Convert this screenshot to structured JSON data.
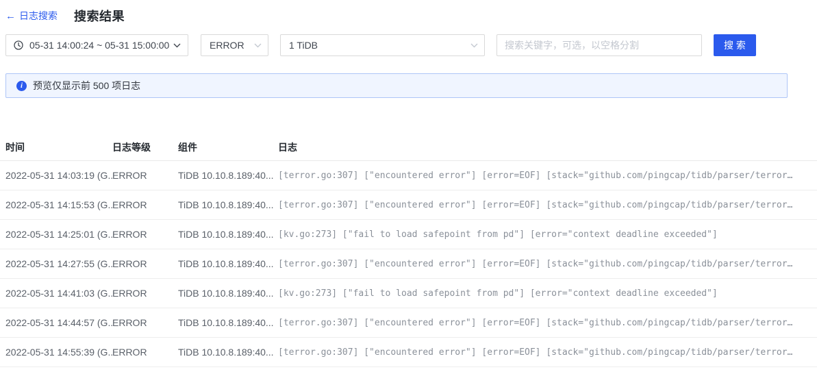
{
  "header": {
    "back_arrow": "←",
    "back_label": "日志搜索",
    "title": "搜索结果"
  },
  "filters": {
    "time_range": "05-31 14:00:24 ~ 05-31 15:00:00",
    "level_selected": "ERROR",
    "components_selected": "1 TiDB",
    "keyword_placeholder": "搜索关键字，可选，以空格分割",
    "search_label": "搜 索"
  },
  "alert": {
    "text": "预览仅显示前 500 项日志"
  },
  "table": {
    "columns": [
      "时间",
      "日志等级",
      "组件",
      "日志"
    ],
    "rows": [
      {
        "time": "2022-05-31 14:03:19 (G...",
        "level": "ERROR",
        "component": "TiDB 10.10.8.189:40...",
        "log": "[terror.go:307] [\"encountered error\"] [error=EOF] [stack=\"github.com/pingcap/tidb/parser/terror…"
      },
      {
        "time": "2022-05-31 14:15:53 (G...",
        "level": "ERROR",
        "component": "TiDB 10.10.8.189:40...",
        "log": "[terror.go:307] [\"encountered error\"] [error=EOF] [stack=\"github.com/pingcap/tidb/parser/terror…"
      },
      {
        "time": "2022-05-31 14:25:01 (G...",
        "level": "ERROR",
        "component": "TiDB 10.10.8.189:40...",
        "log": "[kv.go:273] [\"fail to load safepoint from pd\"] [error=\"context deadline exceeded\"]"
      },
      {
        "time": "2022-05-31 14:27:55 (G...",
        "level": "ERROR",
        "component": "TiDB 10.10.8.189:40...",
        "log": "[terror.go:307] [\"encountered error\"] [error=EOF] [stack=\"github.com/pingcap/tidb/parser/terror…"
      },
      {
        "time": "2022-05-31 14:41:03 (G...",
        "level": "ERROR",
        "component": "TiDB 10.10.8.189:40...",
        "log": "[kv.go:273] [\"fail to load safepoint from pd\"] [error=\"context deadline exceeded\"]"
      },
      {
        "time": "2022-05-31 14:44:57 (G...",
        "level": "ERROR",
        "component": "TiDB 10.10.8.189:40...",
        "log": "[terror.go:307] [\"encountered error\"] [error=EOF] [stack=\"github.com/pingcap/tidb/parser/terror…"
      },
      {
        "time": "2022-05-31 14:55:39 (G...",
        "level": "ERROR",
        "component": "TiDB 10.10.8.189:40...",
        "log": "[terror.go:307] [\"encountered error\"] [error=EOF] [stack=\"github.com/pingcap/tidb/parser/terror…"
      }
    ]
  },
  "colors": {
    "primary": "#2b5aed",
    "alert_bg": "#f0f5ff",
    "alert_border": "#aec5f7"
  }
}
